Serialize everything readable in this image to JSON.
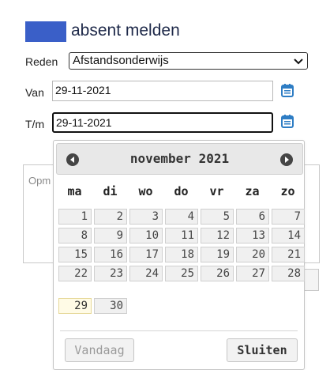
{
  "header": {
    "title": "absent melden",
    "accent_color": "#3a5fc8"
  },
  "form": {
    "reden_label": "Reden",
    "reden_value": "Afstandsonderwijs",
    "van_label": "Van",
    "van_value": "29-11-2021",
    "tm_label": "T/m",
    "tm_value": "29-11-2021",
    "remark_placeholder": "Opm"
  },
  "datepicker": {
    "month_title": "november 2021",
    "prev_icon": "circle-arrow-left-icon",
    "next_icon": "circle-arrow-right-icon",
    "weekdays": [
      "ma",
      "di",
      "wo",
      "do",
      "vr",
      "za",
      "zo"
    ],
    "weeks": [
      [
        "1",
        "2",
        "3",
        "4",
        "5",
        "6",
        "7"
      ],
      [
        "8",
        "9",
        "10",
        "11",
        "12",
        "13",
        "14"
      ],
      [
        "15",
        "16",
        "17",
        "18",
        "19",
        "20",
        "21"
      ],
      [
        "22",
        "23",
        "24",
        "25",
        "26",
        "27",
        "28"
      ],
      [
        "29",
        "30"
      ]
    ],
    "selected_day": "29",
    "today_button": "Vandaag",
    "close_button": "Sluiten"
  }
}
